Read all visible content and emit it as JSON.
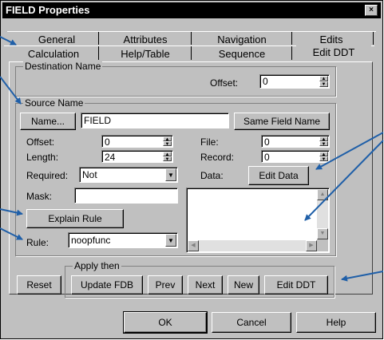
{
  "window": {
    "title": "FIELD Properties",
    "close_glyph": "×"
  },
  "tabs_back": [
    "General",
    "Attributes",
    "Navigation",
    "Edits"
  ],
  "tabs_front": [
    "Calculation",
    "Help/Table",
    "Sequence",
    "Edit DDT"
  ],
  "destination": {
    "group_label": "Destination Name",
    "offset_label": "Offset:",
    "offset_value": "0"
  },
  "source": {
    "group_label": "Source Name",
    "name_button": "Name...",
    "name_value": "FIELD",
    "same_field_button": "Same Field Name",
    "offset_label": "Offset:",
    "offset_value": "0",
    "length_label": "Length:",
    "length_value": "24",
    "required_label": "Required:",
    "required_value": "Not",
    "mask_label": "Mask:",
    "mask_value": "",
    "file_label": "File:",
    "file_value": "0",
    "record_label": "Record:",
    "record_value": "0",
    "data_label": "Data:",
    "edit_data_button": "Edit Data",
    "explain_rule_button": "Explain Rule",
    "rule_label": "Rule:",
    "rule_value": "noopfunc"
  },
  "apply": {
    "group_label": "Apply then",
    "reset": "Reset",
    "update_fdb": "Update FDB",
    "prev": "Prev",
    "next": "Next",
    "new": "New",
    "edit_ddt": "Edit DDT"
  },
  "footer": {
    "ok": "OK",
    "cancel": "Cancel",
    "help": "Help"
  },
  "colors": {
    "face": "#c0c0c0",
    "arrow": "#1f5fa8",
    "title_bg": "#000000"
  }
}
